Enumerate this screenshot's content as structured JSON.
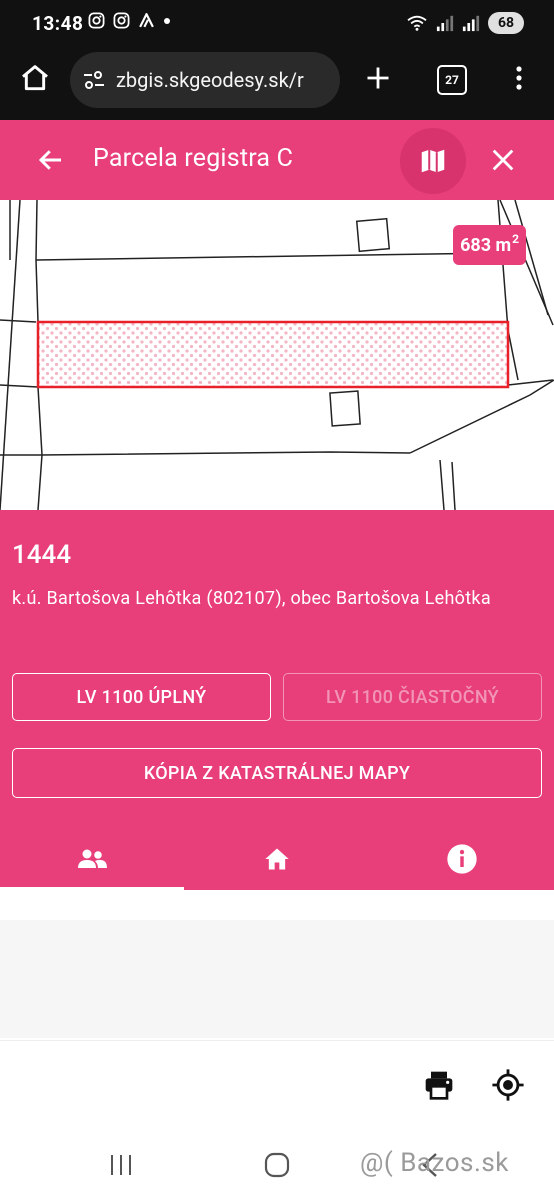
{
  "status_bar": {
    "time": "13:48",
    "battery": "68"
  },
  "browser": {
    "url": "zbgis.skgeodesy.sk/r",
    "tab_count": "27"
  },
  "header": {
    "title": "Parcela registra C"
  },
  "map": {
    "area_value": "683 m",
    "area_unit_sup": "2",
    "colors": {
      "parcel_outline": "#e8202a",
      "parcel_fill": "#f4b6c4"
    }
  },
  "parcel": {
    "number": "1444",
    "description": "k.ú. Bartošova Lehôtka (802107), obec Bartošova Lehôtka"
  },
  "buttons": {
    "lv_full": "LV 1100 ÚPLNÝ",
    "lv_partial": "LV 1100 ČIASTOČNÝ",
    "map_copy": "KÓPIA Z KATASTRÁLNEJ MAPY"
  },
  "tabs": [
    {
      "icon": "people-icon",
      "active": true
    },
    {
      "icon": "home-icon",
      "active": false
    },
    {
      "icon": "info-icon",
      "active": false
    }
  ],
  "toolbar": {
    "icons": [
      "print-icon",
      "locate-icon"
    ]
  },
  "watermark": {
    "text": "@( Bazos.sk"
  },
  "theme": {
    "accent": "#e83e79",
    "dark_bar": "#111111"
  }
}
